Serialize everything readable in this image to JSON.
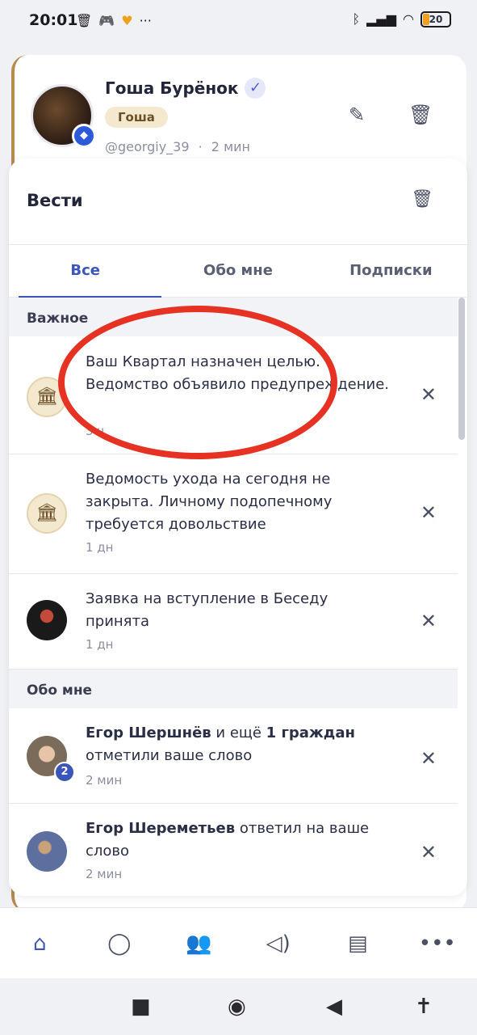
{
  "status_bar": {
    "time": "20:01",
    "left_icons": [
      "trash-icon",
      "gamepad-icon",
      "heart-icon",
      "more-icon"
    ],
    "right_icons": [
      "bluetooth-icon",
      "signal-icon",
      "wifi-icon"
    ],
    "battery": "20",
    "more": "···"
  },
  "post": {
    "author": "Гоша Бурёнок",
    "verified_mark": "✓",
    "nickname": "Гоша",
    "handle": "@georgiy_39",
    "separator": "·",
    "time": "2 мин"
  },
  "sheet": {
    "title": "Вести",
    "tabs": [
      {
        "label": "Все",
        "active": true
      },
      {
        "label": "Обо мне",
        "active": false
      },
      {
        "label": "Подписки",
        "active": false
      }
    ],
    "sections": [
      {
        "header": "Важное",
        "items": [
          {
            "text": "Ваш Квартал назначен целью. Ведомство объявило предупреждение.",
            "time": "3 ч"
          },
          {
            "text": "Ведомость ухода на сегодня не закрыта. Личному подопечному требуется довольствие",
            "time": "1 дн"
          },
          {
            "text": "Заявка на вступление в Беседу принята",
            "time": "1 дн"
          }
        ]
      },
      {
        "header": "Обо мне",
        "items": [
          {
            "actor": "Егор Шершнёв",
            "mid": " и ещё ",
            "extra": "1 граждан",
            "rest": "отметили ваше слово",
            "time": "2 мин",
            "badge": "2"
          },
          {
            "actor": "Егор Шереметьев",
            "rest": " ответил на ваше слово",
            "time": "2 мин"
          }
        ]
      }
    ]
  },
  "bottom_nav": [
    "home-icon",
    "chat-icon",
    "people-icon",
    "megaphone-icon",
    "map-icon",
    "more-icon"
  ],
  "colors": {
    "accent": "#3c55b8",
    "annotation": "#e53223",
    "chip_bg": "#f4e8cf"
  }
}
